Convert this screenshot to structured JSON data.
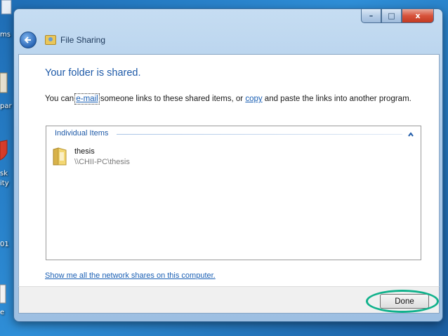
{
  "desktop": {
    "fragments": [
      "ms",
      "par",
      "sk",
      "ity",
      "01",
      "e"
    ]
  },
  "window": {
    "title": "File Sharing",
    "controls": {
      "minimize": "–",
      "maximize": "□",
      "close": "x"
    }
  },
  "content": {
    "heading": "Your folder is shared.",
    "desc_prefix": "You can ",
    "email_link": "e-mail",
    "desc_middle": " someone links to these shared items, or ",
    "copy_link": "copy",
    "desc_suffix": " and paste the links into another program.",
    "group_label": "Individual Items",
    "items": [
      {
        "name": "thesis",
        "path": "\\\\CHII-PC\\thesis"
      }
    ],
    "network_link": "Show me all the network shares on this computer."
  },
  "footer": {
    "done_label": "Done"
  },
  "colors": {
    "accent": "#1e5aa8",
    "link": "#1a5fb4",
    "highlight": "#11b28c"
  }
}
